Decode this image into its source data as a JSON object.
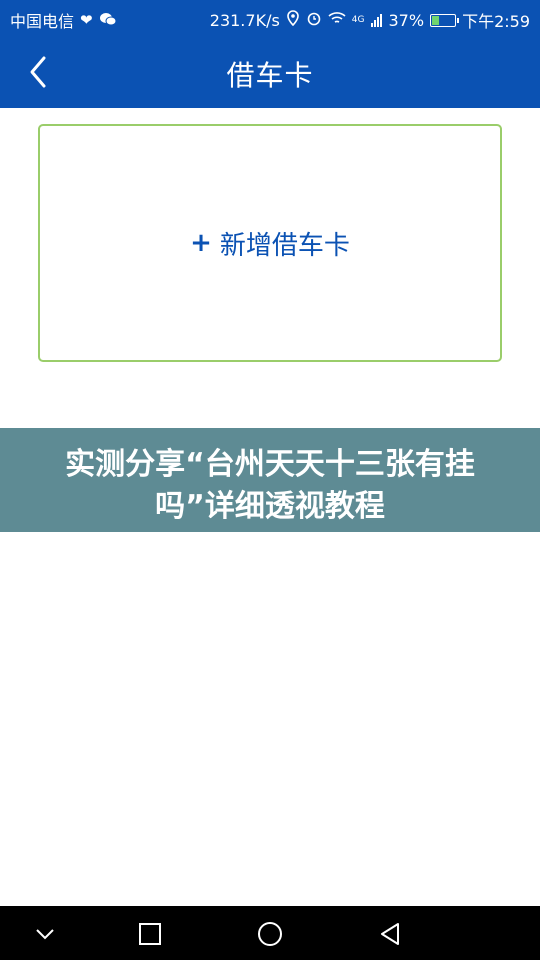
{
  "status_bar": {
    "carrier": "中国电信",
    "speed": "231.7K/s",
    "network": "4G",
    "battery": "37%",
    "battery_level": 0.37,
    "time": "下午2:59",
    "icons": [
      "heart-icon",
      "wechat-icon",
      "location-icon",
      "alarm-icon",
      "wifi-icon",
      "signal-icon",
      "battery-icon"
    ]
  },
  "header": {
    "title": "借车卡",
    "background": "#0b52b3"
  },
  "card": {
    "plus": "+",
    "label": "新增借车卡",
    "border_color": "#9acd6a",
    "text_color": "#0b52b3"
  },
  "banner": {
    "text": "实测分享“台州天天十三张有挂吗”详细透视教程",
    "background": "#5e8b94"
  },
  "nav": {
    "icons": [
      "chevron-down-icon",
      "square-icon",
      "circle-icon",
      "triangle-back-icon"
    ]
  }
}
